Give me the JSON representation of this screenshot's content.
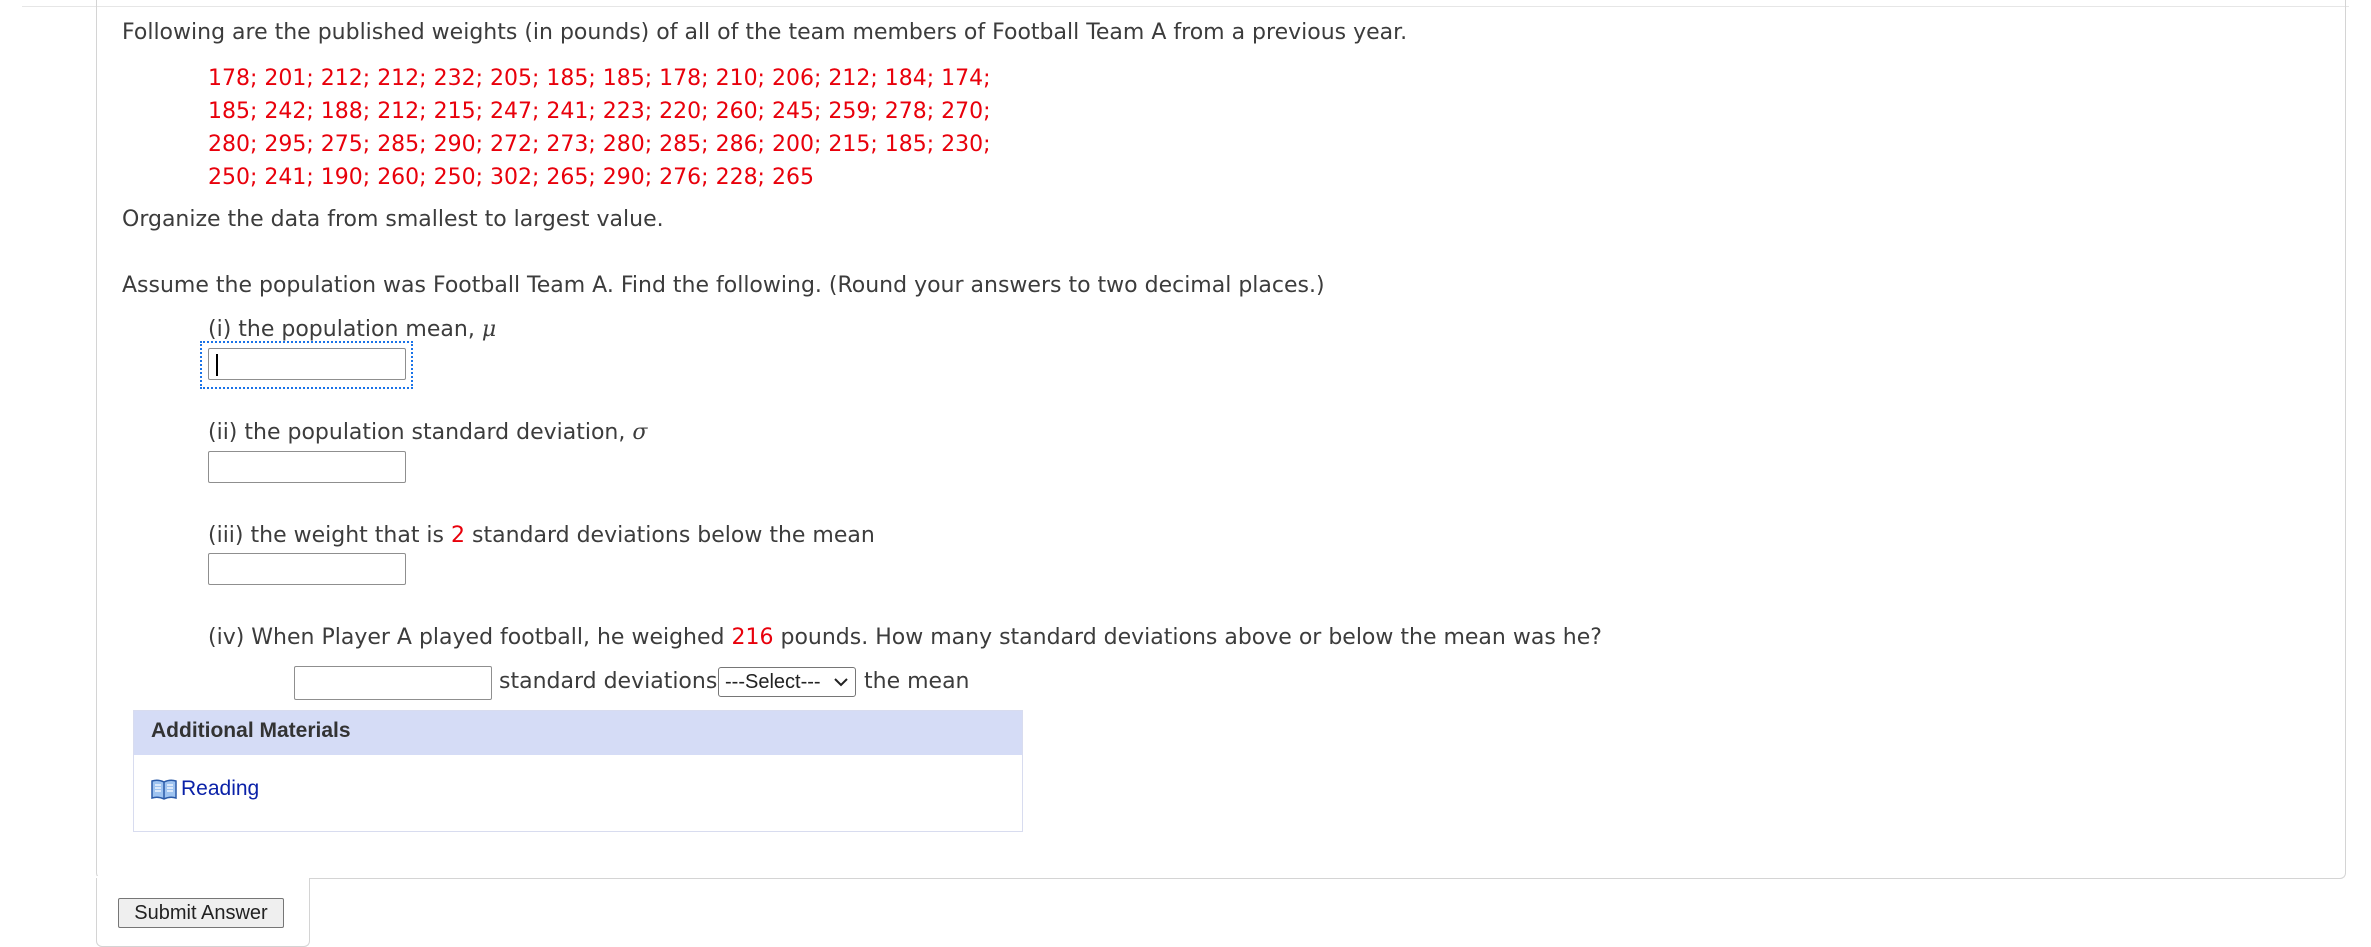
{
  "intro": "Following are the published weights (in pounds) of all of the team members of Football Team A from a previous year.",
  "data_lines": [
    "178; 201; 212; 212; 232; 205; 185; 185; 178; 210; 206; 212; 184; 174;",
    "185; 242; 188; 212; 215; 247; 241; 223; 220; 260; 245; 259; 278; 270;",
    "280; 295; 275; 285; 290; 272; 273; 280; 285; 286; 200; 215; 185; 230;",
    "250; 241; 190; 260; 250; 302; 265; 290; 276; 228; 265"
  ],
  "organize": "Organize the data from smallest to largest value.",
  "assume": "Assume the population was Football Team A. Find the following. (Round your answers to two decimal places.)",
  "q1": {
    "label": "(i) the population mean, ",
    "symbol": "μ",
    "value": ""
  },
  "q2": {
    "label": "(ii) the population standard deviation, ",
    "symbol": "σ",
    "value": ""
  },
  "q3": {
    "label_before": "(iii) the weight that is ",
    "number": "2",
    "label_after": " standard deviations below the mean",
    "value": ""
  },
  "q4": {
    "label_before": "(iv) When Player A played football, he weighed ",
    "number": "216",
    "label_after": " pounds. How many standard deviations above or below the mean was he?",
    "value": "",
    "unit_text": "standard deviations",
    "select_value": "---Select---",
    "after_select": "the mean"
  },
  "additional": {
    "title": "Additional Materials",
    "link": "Reading"
  },
  "submit": "Submit Answer",
  "colors": {
    "accent_red": "#e8000b",
    "link_blue": "#0a21a8",
    "panel_header": "#d5dcf6",
    "focus": "#1a73e8"
  },
  "icons": {
    "reading": "book-icon",
    "select": "chevron-down-icon"
  }
}
